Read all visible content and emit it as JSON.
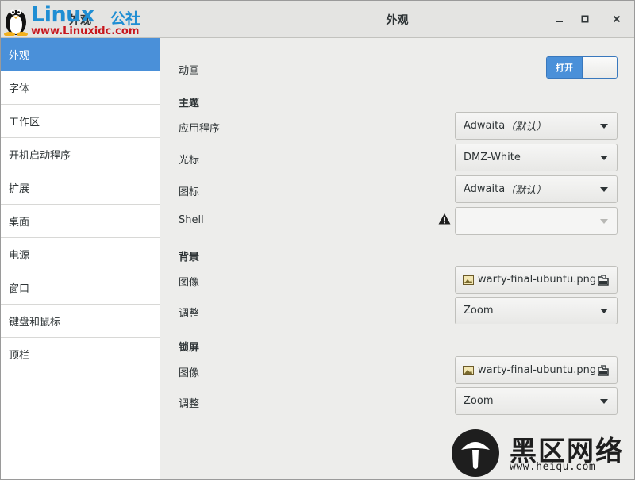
{
  "window": {
    "title": "外观",
    "left_title": "外观"
  },
  "logo": {
    "brand": "Linux",
    "brand_cn": "公社",
    "url": "www.Linuxidc.com"
  },
  "sidebar": {
    "items": [
      {
        "label": "外观",
        "active": true
      },
      {
        "label": "字体"
      },
      {
        "label": "工作区"
      },
      {
        "label": "开机启动程序"
      },
      {
        "label": "扩展"
      },
      {
        "label": "桌面"
      },
      {
        "label": "电源"
      },
      {
        "label": "窗口"
      },
      {
        "label": "键盘和鼠标"
      },
      {
        "label": "顶栏"
      }
    ]
  },
  "main": {
    "animation": {
      "label": "动画",
      "switch_label": "打开",
      "state": "on"
    },
    "themes": {
      "section": "主题",
      "applications": {
        "label": "应用程序",
        "value": "Adwaita",
        "suffix": "（默认）"
      },
      "cursor": {
        "label": "光标",
        "value": "DMZ-White"
      },
      "icons": {
        "label": "图标",
        "value": "Adwaita",
        "suffix": "（默认）"
      },
      "shell": {
        "label": "Shell",
        "value": "",
        "warning_icon": "warning-icon"
      }
    },
    "background": {
      "section": "背景",
      "image": {
        "label": "图像",
        "file": "warty-final-ubuntu.png"
      },
      "adjustment": {
        "label": "调整",
        "value": "Zoom"
      }
    },
    "lock_screen": {
      "section": "锁屏",
      "image": {
        "label": "图像",
        "file": "warty-final-ubuntu.png"
      },
      "adjustment": {
        "label": "调整",
        "value": "Zoom"
      }
    }
  },
  "watermark": {
    "cn": "黑区网络",
    "url": "www.heiqu.com"
  },
  "colors": {
    "accent": "#4a90d9",
    "logo_blue": "#1f8ed3",
    "logo_red": "#c8161d"
  }
}
